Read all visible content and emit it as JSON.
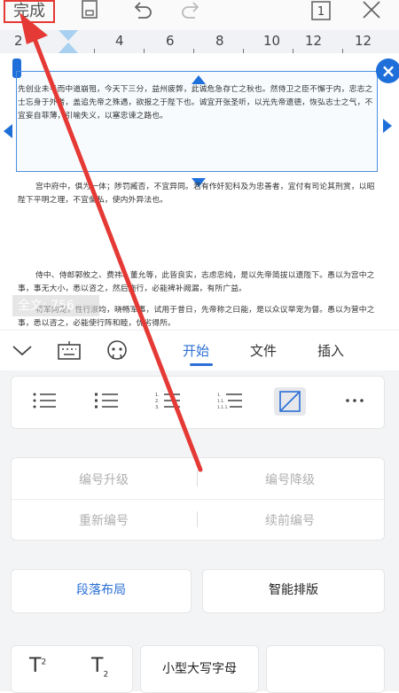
{
  "toolbar": {
    "done_label": "完成",
    "page_number": "1"
  },
  "ruler": {
    "numbers": [
      "2",
      "2",
      "4",
      "6",
      "8",
      "10",
      "12"
    ]
  },
  "document": {
    "para1": "先创业未半而中道崩殂，今天下三分，益州疲弊，此诚危急存亡之秋也。然侍卫之臣不懈于内，忠志之士忘身于外者，盖追先帝之殊遇，欲报之于陛下也。诚宜开张圣听，以光先帝遗德，恢弘志士之气，不宜妄自菲薄，引喻失义，以塞忠谏之路也。",
    "para2": "宫中府中，俱为一体；陟罚臧否，不宜异同。若有作奸犯科及为忠善者，宜付有司论其刑赏，以昭陛下平明之理，不宜偏私，使内外异法也。",
    "para3": "侍中、侍郎郭攸之、费祎、董允等，此皆良实，志虑忠纯，是以先帝简拔以遗陛下。愚以为宫中之事，事无大小，悉以咨之，然后施行，必能裨补阙漏，有所广益。",
    "para4": "将军向宠，性行淑均，晓畅军事，试用于昔日，先帝称之曰能，是以众议举宠为督。愚以为营中之事，悉以咨之，必能使行阵和睦，优劣得所。",
    "word_count": "全文: 756"
  },
  "tabs": {
    "start": "开始",
    "file": "文件",
    "insert": "插入"
  },
  "numbering": {
    "promote": "编号升级",
    "demote": "编号降级",
    "renumber": "重新编号",
    "continue": "续前编号"
  },
  "layout": {
    "paragraph_layout": "段落布局",
    "smart_layout": "智能排版"
  },
  "format": {
    "small_caps": "小型大写字母",
    "superscript_label": "T",
    "superscript_sub": "2",
    "subscript_label": "T",
    "subscript_sub": "2"
  },
  "colors": {
    "accent": "#2b6fd6",
    "highlight_red": "#e53935"
  }
}
